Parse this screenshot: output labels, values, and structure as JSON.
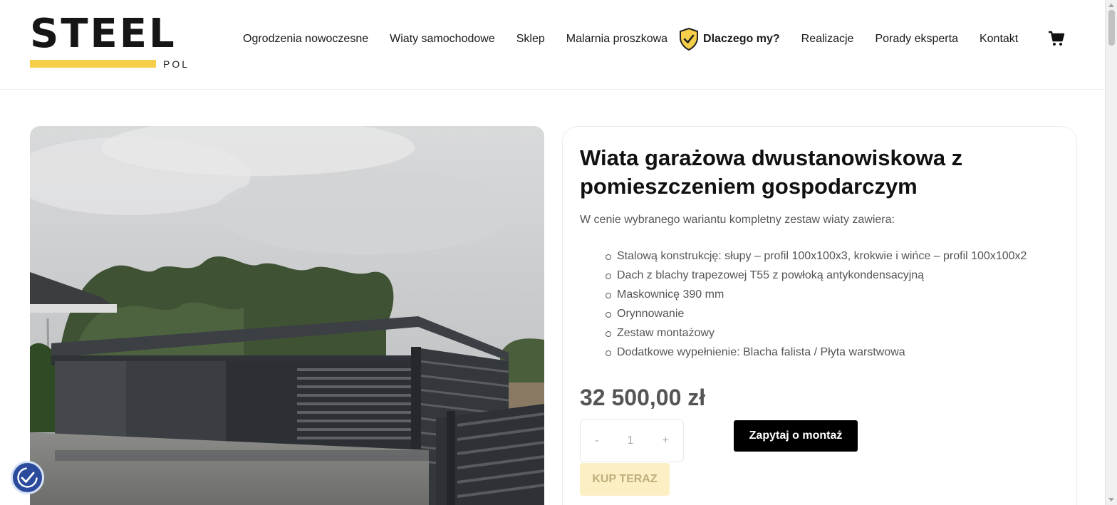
{
  "brand": {
    "name": "STEEL",
    "sub": "POL",
    "accent_color": "#f5cf4a"
  },
  "nav": {
    "items": [
      {
        "label": "Ogrodzenia nowoczesne"
      },
      {
        "label": "Wiaty samochodowe"
      },
      {
        "label": "Sklep"
      },
      {
        "label": "Malarnia proszkowa"
      },
      {
        "label": "Dlaczego my?",
        "icon": "shield-check-icon"
      },
      {
        "label": "Realizacje"
      },
      {
        "label": "Porady eksperta"
      },
      {
        "label": "Kontakt"
      }
    ],
    "cart_icon": "cart-icon"
  },
  "product": {
    "title": "Wiata garażowa dwustanowiskowa z pomieszczeniem gospodarczym",
    "intro": "W cenie wybranego wariantu kompletny zestaw wiaty zawiera:",
    "features": [
      "Stalową konstrukcję: słupy – profil 100x100x3, krokwie i wińce – profil 100x100x2",
      "Dach z blachy trapezowej T55 z powłoką antykondensacyjną",
      "Maskownicę 390 mm",
      "Orynnowanie",
      "Zestaw montażowy",
      "Dodatkowe wypełnienie: Blacha falista / Płyta warstwowa"
    ],
    "price": "32 500,00 zł",
    "quantity": {
      "minus": "-",
      "value": "1",
      "plus": "+"
    },
    "ask_button": "Zapytaj o montaż",
    "buy_button": "KUP TERAZ"
  },
  "colors": {
    "button_dark": "#000000",
    "buy_button_bg": "#fbefc3"
  }
}
